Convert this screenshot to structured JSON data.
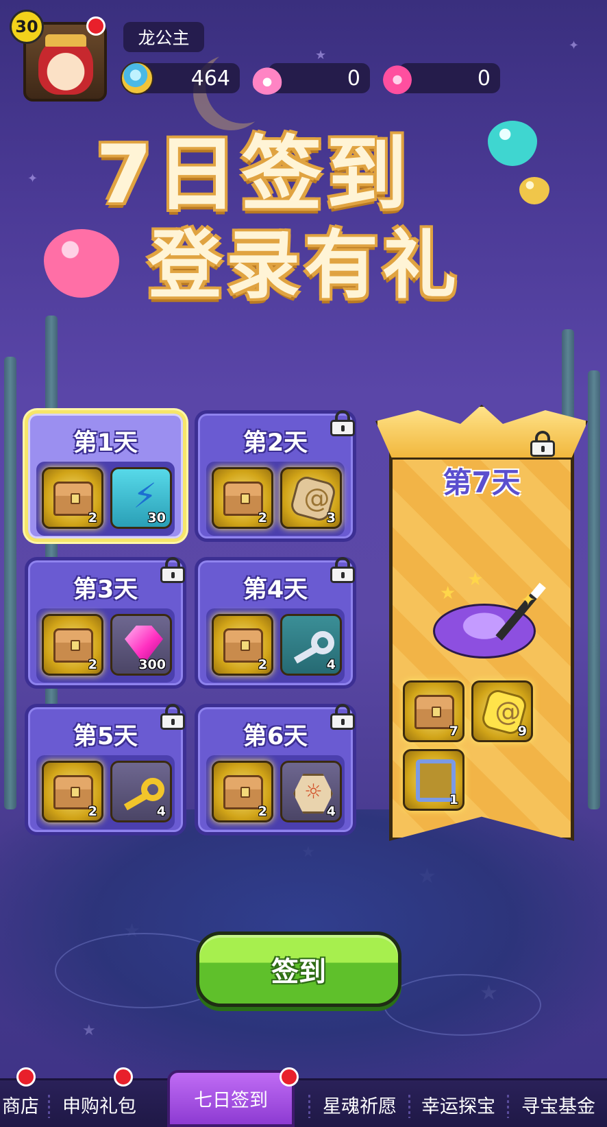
{
  "player": {
    "level": "30",
    "name": "龙公主"
  },
  "resources": [
    {
      "icon": "diamond-coin-icon",
      "value": "464"
    },
    {
      "icon": "pink-flame-icon",
      "value": "0"
    },
    {
      "icon": "pink-heart-gem-icon",
      "value": "0"
    }
  ],
  "title": {
    "line1": "7日签到",
    "line2": "登录有礼"
  },
  "days": [
    {
      "label": "第1天",
      "locked": false,
      "active": true,
      "rewards": [
        {
          "icon": "treasure-chest-icon",
          "count": "2"
        },
        {
          "icon": "lightning-energy-icon",
          "count": "30"
        }
      ]
    },
    {
      "label": "第2天",
      "locked": true,
      "active": false,
      "rewards": [
        {
          "icon": "treasure-chest-icon",
          "count": "2"
        },
        {
          "icon": "spiral-rune-stone-icon",
          "count": "3"
        }
      ]
    },
    {
      "label": "第3天",
      "locked": true,
      "active": false,
      "rewards": [
        {
          "icon": "treasure-chest-icon",
          "count": "2"
        },
        {
          "icon": "pink-gem-icon",
          "count": "300"
        }
      ]
    },
    {
      "label": "第4天",
      "locked": true,
      "active": false,
      "rewards": [
        {
          "icon": "treasure-chest-icon",
          "count": "2"
        },
        {
          "icon": "silver-key-icon",
          "count": "4"
        }
      ]
    },
    {
      "label": "第5天",
      "locked": true,
      "active": false,
      "rewards": [
        {
          "icon": "treasure-chest-icon",
          "count": "2"
        },
        {
          "icon": "gold-key-icon",
          "count": "4"
        }
      ]
    },
    {
      "label": "第6天",
      "locked": true,
      "active": false,
      "rewards": [
        {
          "icon": "treasure-chest-icon",
          "count": "2"
        },
        {
          "icon": "sun-emblem-icon",
          "count": "4"
        }
      ]
    }
  ],
  "day7": {
    "label": "第7天",
    "locked": true,
    "featured": "magic-hat-icon",
    "rewards": [
      {
        "icon": "treasure-chest-icon",
        "count": "7"
      },
      {
        "icon": "gold-crystal-icon",
        "count": "9"
      },
      {
        "icon": "avatar-frame-icon",
        "count": "1"
      }
    ]
  },
  "sign_button": "签到",
  "tabs": [
    {
      "label": "商店",
      "dot": true
    },
    {
      "label": "申购礼包",
      "dot": true
    },
    {
      "label": "七日签到",
      "dot": true,
      "active": true
    },
    {
      "label": "星魂祈愿",
      "dot": false
    },
    {
      "label": "幸运探宝",
      "dot": false
    },
    {
      "label": "寻宝基金",
      "dot": false
    }
  ],
  "colors": {
    "background": "#4b3a96",
    "card": "#6a5bd2",
    "card_active_border": "#f6e56a",
    "day7_gold": "#f6c25a",
    "sign_green": "#5fc02b",
    "tab_active": "#a94ee6",
    "notification_red": "#e8202b"
  }
}
